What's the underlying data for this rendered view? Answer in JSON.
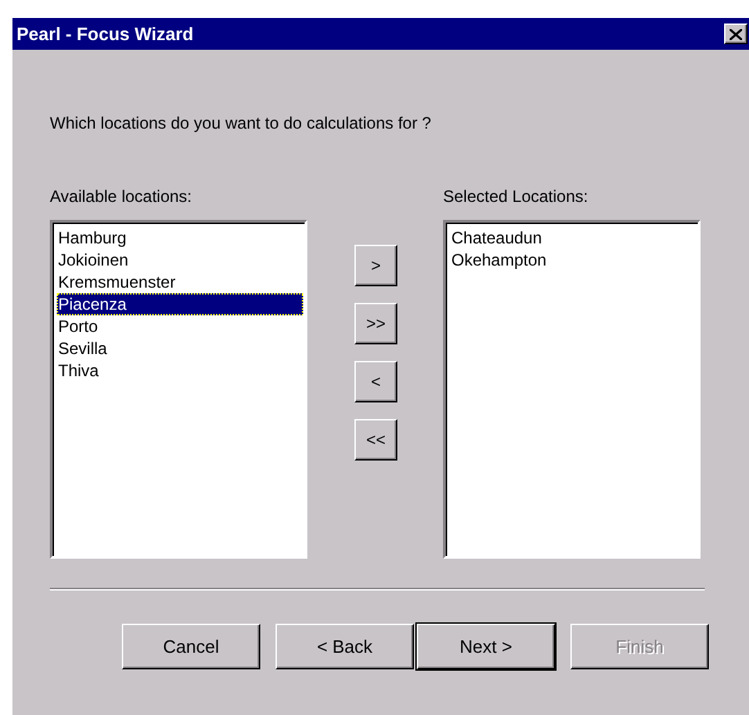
{
  "window": {
    "title": "Pearl - Focus Wizard"
  },
  "prompt": "Which locations do you want to do calculations for ?",
  "available": {
    "label": "Available locations:",
    "items": [
      {
        "label": "Hamburg",
        "selected": false
      },
      {
        "label": "Jokioinen",
        "selected": false
      },
      {
        "label": "Kremsmuenster",
        "selected": false
      },
      {
        "label": "Piacenza",
        "selected": true
      },
      {
        "label": "Porto",
        "selected": false
      },
      {
        "label": "Sevilla",
        "selected": false
      },
      {
        "label": "Thiva",
        "selected": false
      }
    ]
  },
  "move_buttons": [
    ">",
    ">>",
    "<",
    "<<"
  ],
  "chosen": {
    "label": "Selected Locations:",
    "items": [
      {
        "label": "Chateaudun",
        "selected": false
      },
      {
        "label": "Okehampton",
        "selected": false
      }
    ]
  },
  "buttons": [
    {
      "label": "Cancel",
      "default": false,
      "disabled": false
    },
    {
      "label": "< Back",
      "default": false,
      "disabled": false
    },
    {
      "label": "Next >",
      "default": true,
      "disabled": false
    },
    {
      "label": "Finish",
      "default": false,
      "disabled": true
    }
  ]
}
